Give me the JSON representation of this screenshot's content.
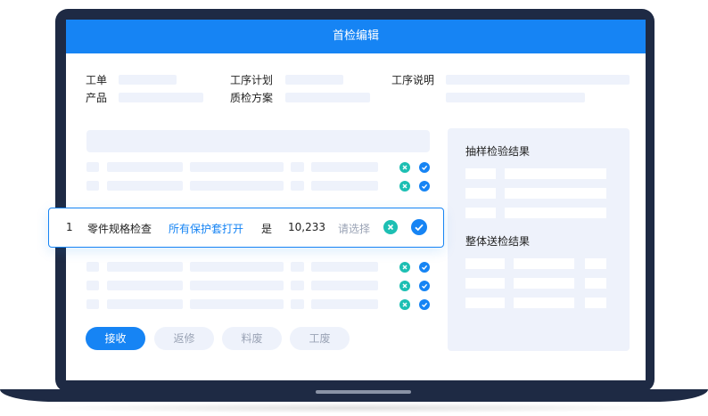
{
  "window": {
    "title": "首检编辑"
  },
  "form": {
    "work_order_label": "工单",
    "process_plan_label": "工序计划",
    "process_desc_label": "工序说明",
    "product_label": "产品",
    "inspection_plan_label": "质检方案"
  },
  "highlight_row": {
    "index": "1",
    "item": "零件规格检查",
    "standard": "所有保护套打开",
    "flag": "是",
    "value": "10,233",
    "select_placeholder": "请选择"
  },
  "side_panel": {
    "sample_title": "抽样检验结果",
    "overall_title": "整体送检结果"
  },
  "actions": {
    "receive": "接收",
    "rework": "返修",
    "material_scrap": "料废",
    "work_scrap": "工废"
  },
  "colors": {
    "accent": "#1684f4",
    "teal": "#1dbfb3",
    "placeholder_bar": "#eef2fb",
    "frame": "#1e2a44"
  }
}
